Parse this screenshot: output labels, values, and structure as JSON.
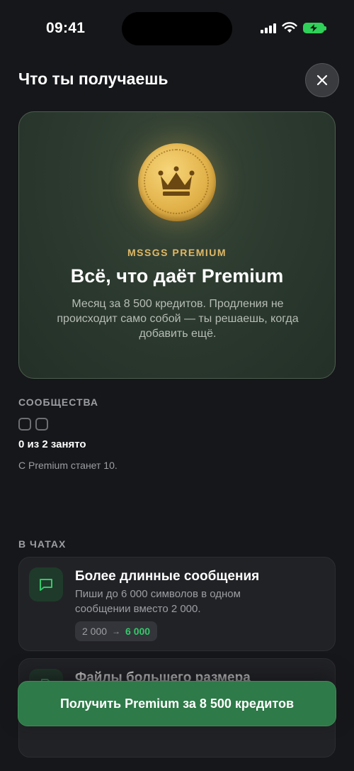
{
  "status": {
    "time": "09:41"
  },
  "header": {
    "title": "Что ты получаешь"
  },
  "hero": {
    "eyebrow": "MSSGS PREMIUM",
    "title": "Всё, что даёт Premium",
    "description": "Месяц за 8 500 кредитов. Продления не происходит само собой — ты решаешь, когда добавить ещё.",
    "icon": "crown-coin"
  },
  "communities": {
    "label": "СООБЩЕСТВА",
    "slots_used": 0,
    "slots_total": 2,
    "occupied_text": "0 из 2 занято",
    "premium_note": "С Premium станет 10."
  },
  "chats": {
    "label": "В ЧАТАХ",
    "features": [
      {
        "icon": "message-icon",
        "title": "Более длинные сообщения",
        "description": "Пиши до 6 000 символов в одном сообщении вместо 2 000.",
        "from": "2 000",
        "to": "6 000"
      },
      {
        "icon": "file-icon",
        "title": "Файлы большего размера"
      }
    ]
  },
  "cta": {
    "label": "Получить Premium за 8 500 кредитов"
  },
  "colors": {
    "accent": "#2e7a48",
    "highlight": "#35c76a",
    "gold": "#e0b866"
  }
}
